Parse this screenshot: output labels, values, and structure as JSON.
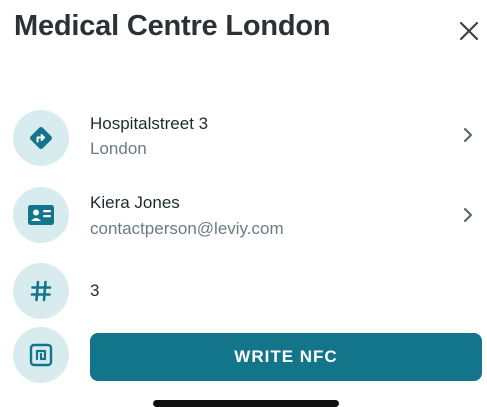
{
  "header": {
    "title": "Medical Centre London",
    "close_icon": "close-icon"
  },
  "address": {
    "icon": "directions-icon",
    "street": "Hospitalstreet 3",
    "city": "London"
  },
  "contact": {
    "icon": "contact-card-icon",
    "name": "Kiera Jones",
    "email": "contactperson@leviy.com"
  },
  "number": {
    "icon": "hash-icon",
    "value": "3"
  },
  "nfc": {
    "icon": "nfc-icon",
    "button_label": "WRITE NFC"
  },
  "colors": {
    "accent": "#12758a",
    "icon_circle": "#d8ecef",
    "secondary_text": "#6a7c83"
  }
}
